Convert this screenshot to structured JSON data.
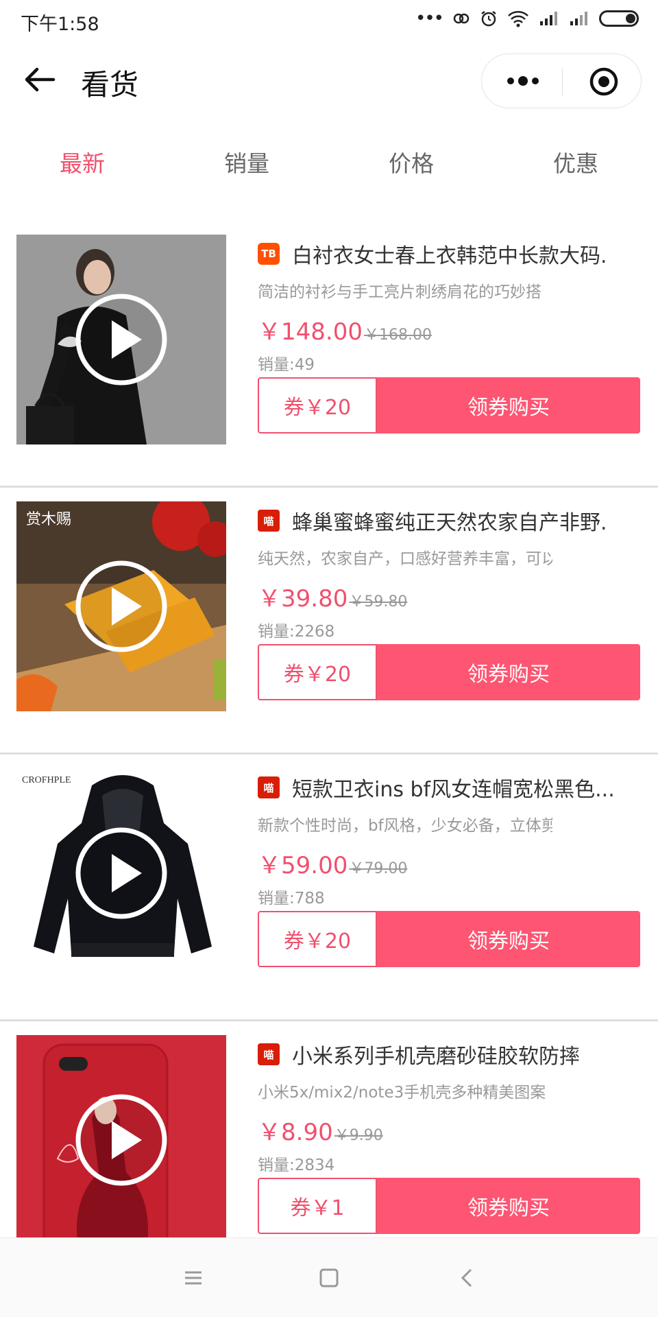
{
  "status_bar": {
    "time": "下午1:58"
  },
  "nav": {
    "title": "看货"
  },
  "tabs": [
    {
      "label": "最新",
      "active": true
    },
    {
      "label": "销量",
      "active": false
    },
    {
      "label": "价格",
      "active": false
    },
    {
      "label": "优惠",
      "active": false
    }
  ],
  "products": [
    {
      "platform": "TB",
      "title": "白衬衣女士春上衣韩范中长款大码.",
      "desc": "简洁的衬衫与手工亮片刺绣肩花的巧妙搭",
      "price": "￥148.00",
      "original_price": "￥168.00",
      "sales": "销量:49",
      "coupon": "券￥20",
      "buy": "领券购买"
    },
    {
      "platform": "喵",
      "title": "蜂巢蜜蜂蜜纯正天然农家自产非野.",
      "desc": "纯天然，农家自产，口感好营养丰富，可以",
      "price": "￥39.80",
      "original_price": "￥59.80",
      "sales": "销量:2268",
      "coupon": "券￥20",
      "buy": "领券购买",
      "image_text": "赏木赐"
    },
    {
      "platform": "喵",
      "title": "短款卫衣ins bf风女连帽宽松黑色...",
      "desc": "新款个性时尚，bf风格，少女必备，立体剪",
      "price": "￥59.00",
      "original_price": "￥79.00",
      "sales": "销量:788",
      "coupon": "券￥20",
      "buy": "领券购买",
      "image_text": "CROFHPLE"
    },
    {
      "platform": "喵",
      "title": "小米系列手机壳磨砂硅胶软防摔",
      "desc": "小米5x/mix2/note3手机壳多种精美图案",
      "price": "￥8.90",
      "original_price": "￥9.90",
      "sales": "销量:2834",
      "coupon": "券￥1",
      "buy": "领券购买"
    }
  ],
  "colors": {
    "accent": "#f0506e",
    "button": "#fe5572"
  }
}
